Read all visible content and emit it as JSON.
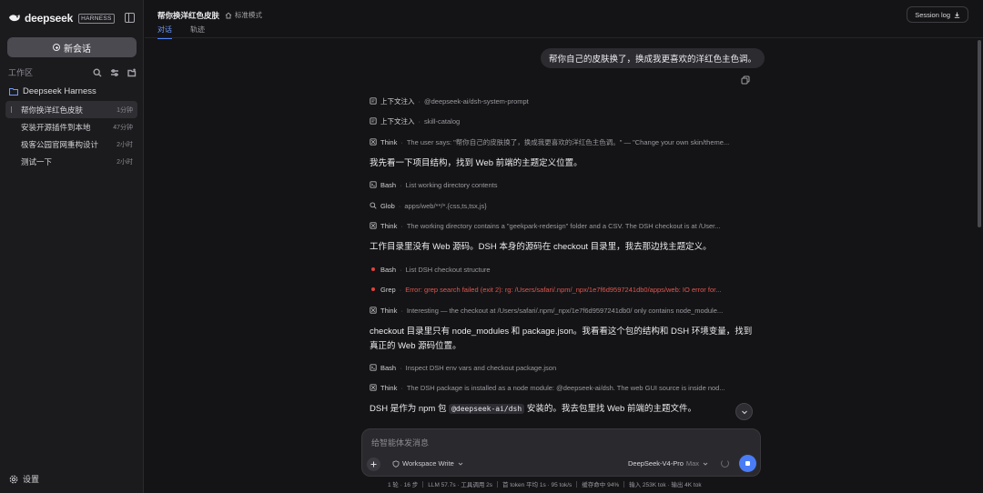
{
  "sidebar": {
    "brand_name": "deepseek",
    "brand_badge": "HARNESS",
    "new_chat_label": "新会话",
    "workspace_label": "工作区",
    "project_name": "Deepseek Harness",
    "sessions": [
      {
        "title": "帮你换洋红色皮肤",
        "time": "1分钟"
      },
      {
        "title": "安装开源插件到本地",
        "time": "47分钟"
      },
      {
        "title": "极客公园官网重构设计",
        "time": "2小时"
      },
      {
        "title": "测试一下",
        "time": "2小时"
      }
    ],
    "settings_label": "设置"
  },
  "header": {
    "title": "帮你换洋红色皮肤",
    "mode": "标准模式",
    "tabs": [
      "对话",
      "轨迹"
    ],
    "session_log": "Session log"
  },
  "chat": {
    "user_message": "帮你自己的皮肤换了，换成我更喜欢的洋红色主色调。",
    "steps": [
      {
        "icon": "doc-icon",
        "name": "上下文注入",
        "desc": "@deepseek-ai/dsh-system-prompt"
      },
      {
        "icon": "doc-icon",
        "name": "上下文注入",
        "desc": "skill-catalog"
      },
      {
        "icon": "think-icon",
        "name": "Think",
        "desc": "The user says: \"帮你自己的皮肤换了，换成我更喜欢的洋红色主色调。\" — \"Change your own skin/theme..."
      },
      {
        "icon": "terminal-icon",
        "name": "Bash",
        "desc": "List working directory contents"
      },
      {
        "icon": "search-icon",
        "name": "Glob",
        "desc": "apps/web/**/*.{css,ts,tsx,js}"
      },
      {
        "icon": "think-icon",
        "name": "Think",
        "desc": "The working directory contains a \"geekpark-redesign\" folder and a CSV. The DSH checkout is at /User..."
      },
      {
        "icon": "error-dot",
        "name": "Bash",
        "desc": "List DSH checkout structure"
      },
      {
        "icon": "error-dot",
        "name": "Grep",
        "desc": "Error: grep search failed (exit 2): rg: /Users/safari/.npm/_npx/1e7f6d9597241db0/apps/web: IO error for..."
      },
      {
        "icon": "think-icon",
        "name": "Think",
        "desc": "Interesting — the checkout at /Users/safari/.npm/_npx/1e7f6d9597241db0/ only contains node_module..."
      },
      {
        "icon": "terminal-icon",
        "name": "Bash",
        "desc": "Inspect DSH env vars and checkout package.json"
      },
      {
        "icon": "think-icon",
        "name": "Think",
        "desc": "The DSH package is installed as a node module: @deepseek-ai/dsh. The web GUI source is inside nod..."
      }
    ],
    "paragraphs": [
      "我先看一下项目结构，找到 Web 前端的主题定义位置。",
      "工作目录里没有 Web 源码。DSH 本身的源码在 checkout 目录里，我去那边找主题定义。",
      "checkout 目录里只有 node_modules 和 package.json。我看看这个包的结构和 DSH 环境变量，找到真正的 Web 源码位置。"
    ],
    "last_paragraph": {
      "before": "DSH 是作为 npm 包",
      "code": "@deepseek-ai/dsh",
      "after": "安装的。我去包里找 Web 前端的主题文件。"
    }
  },
  "composer": {
    "placeholder": "给智能体发消息",
    "permission": "Workspace Write",
    "model": "DeepSeek-V4-Pro",
    "model_mode": "Max"
  },
  "status": [
    "1 轮 · 16 步",
    "LLM 57.7s · 工具调用 2s",
    "首 token 平均 1s · 95 tok/s",
    "缓存命中 94%",
    "输入 253K tok · 输出 4K tok"
  ],
  "colors": {
    "accent": "#4a7cf6",
    "error": "#e3423b",
    "background": "#141416"
  }
}
